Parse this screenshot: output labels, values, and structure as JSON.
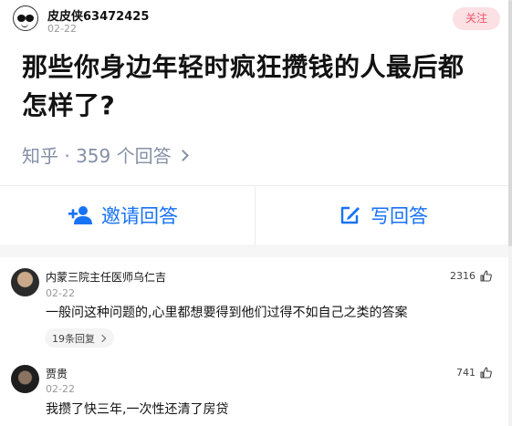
{
  "author": {
    "name": "皮皮侠63472425",
    "date": "02-22",
    "follow_label": "关注"
  },
  "question": {
    "title": "那些你身边年轻时疯狂攒钱的人最后都怎样了?",
    "meta": "知乎 · 359 个回答"
  },
  "actions": {
    "invite_label": "邀请回答",
    "write_label": "写回答"
  },
  "comments": [
    {
      "name": "内蒙三院主任医师乌仁吉",
      "date": "02-22",
      "likes": "2316",
      "text": "一般问这种问题的,心里都想要得到他们过得不如自己之类的答案",
      "replies": "19条回复"
    },
    {
      "name": "贾贵",
      "date": "02-22",
      "likes": "741",
      "text": "我攒了快三年,一次性还清了房贷"
    }
  ],
  "colors": {
    "accent": "#1772f6",
    "follow_bg": "#fbe0e4",
    "follow_text": "#f0566b",
    "meta": "#8590a6"
  },
  "icons": [
    "avatar-icon",
    "chevron-right-icon",
    "add-user-icon",
    "edit-icon",
    "thumbs-up-icon"
  ]
}
